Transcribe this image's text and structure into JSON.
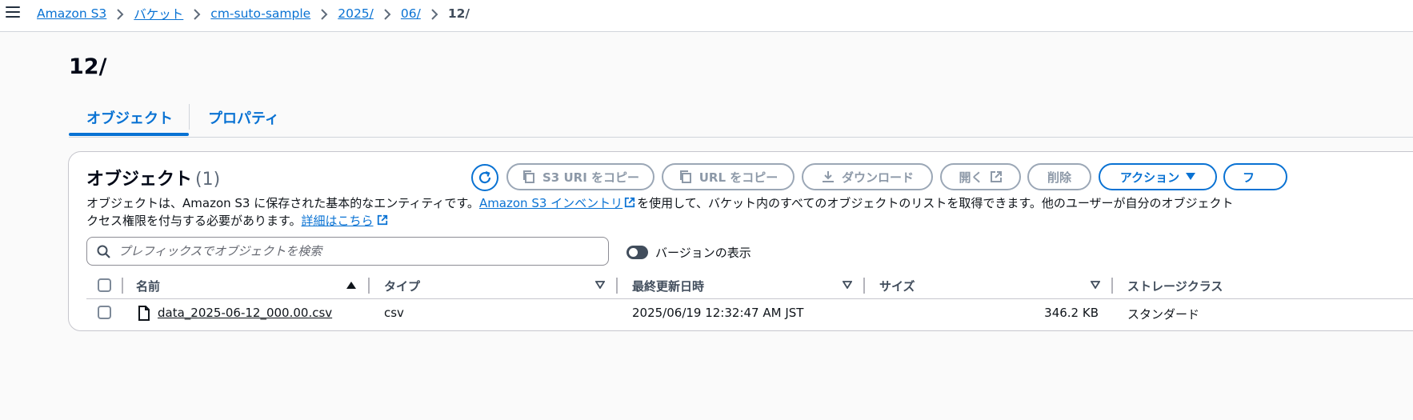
{
  "breadcrumb": {
    "items": [
      "Amazon S3",
      "バケット",
      "cm-suto-sample",
      "2025/",
      "06/"
    ],
    "current": "12/"
  },
  "page": {
    "title": "12/"
  },
  "tabs": [
    {
      "label": "オブジェクト",
      "active": true
    },
    {
      "label": "プロパティ",
      "active": false
    }
  ],
  "objects_panel": {
    "title": "オブジェクト",
    "count": "(1)",
    "buttons": {
      "copy_s3_uri": "S3 URI をコピー",
      "copy_url": "URL をコピー",
      "download": "ダウンロード",
      "open": "開く",
      "delete": "削除",
      "actions": "アクション",
      "create_folder_partial": "フ"
    },
    "description": {
      "part1": "オブジェクトは、Amazon S3 に保存された基本的なエンティティです。",
      "inventory_link": "Amazon S3 インベントリ",
      "part2": "を使用して、バケット内のすべてのオブジェクトのリストを取得できます。他のユーザーが自分のオブジェクト",
      "part3": "クセス権限を付与する必要があります。",
      "learn_more_link": "詳細はこちら"
    },
    "search": {
      "placeholder": "プレフィックスでオブジェクトを検索",
      "value": ""
    },
    "version_toggle": {
      "label": "バージョンの表示",
      "on": false
    }
  },
  "table": {
    "columns": [
      "名前",
      "タイプ",
      "最終更新日時",
      "サイズ",
      "ストレージクラス"
    ],
    "rows": [
      {
        "name": "data_2025-06-12_000.00.csv",
        "type": "csv",
        "last_modified": "2025/06/19 12:32:47 AM JST",
        "size": "346.2 KB",
        "storage_class": "スタンダード"
      }
    ]
  },
  "colors": {
    "accent": "#0972d3",
    "text": "#0f141a",
    "disabled": "#8d99a8"
  }
}
